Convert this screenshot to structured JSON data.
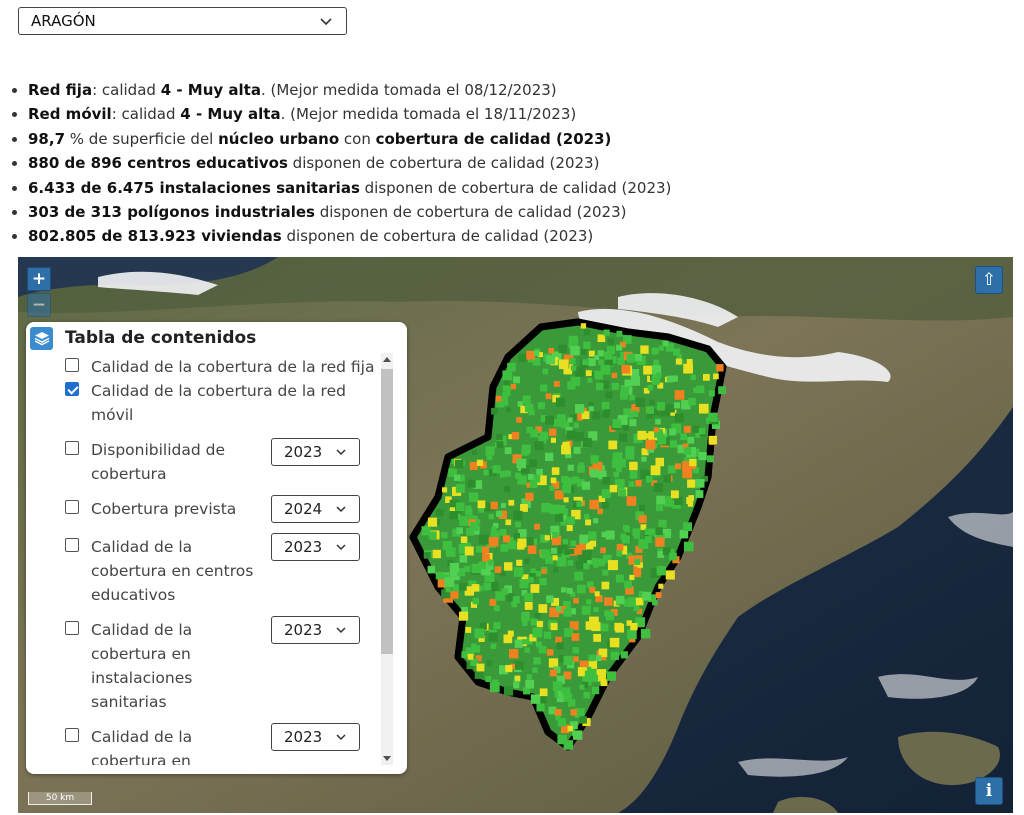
{
  "region_select": {
    "value": "ARAGÓN",
    "icon": "chevron-down-icon"
  },
  "stats": [
    {
      "b1": "Red fija",
      "t1": ": calidad ",
      "b2": "4 - Muy alta",
      "t2": ". (Mejor medida tomada el 08/12/2023)"
    },
    {
      "b1": "Red móvil",
      "t1": ": calidad ",
      "b2": "4 - Muy alta",
      "t2": ". (Mejor medida tomada el 18/11/2023)"
    },
    {
      "b1": "98,7",
      "t1": " % de superficie del ",
      "b2": "núcleo urbano",
      "t2": " con ",
      "b3": "cobertura de calidad (2023)"
    },
    {
      "b1": "880 de 896 centros educativos",
      "t1": " disponen de cobertura de calidad (2023)"
    },
    {
      "b1": "6.433 de 6.475 instalaciones sanitarias",
      "t1": " disponen de cobertura de calidad (2023)"
    },
    {
      "b1": "303 de 313 polígonos industriales",
      "t1": " disponen de cobertura de calidad (2023)"
    },
    {
      "b1": "802.805 de 813.923 viviendas",
      "t1": " disponen de cobertura de calidad (2023)"
    }
  ],
  "map": {
    "zoom_in": "+",
    "zoom_out": "−",
    "top_button": "⇧",
    "info_button": "i",
    "scale": "50 km",
    "colors": {
      "accent": "#2f6fa8",
      "coverage_high": "#3fbf3f",
      "coverage_mid": "#e8e020",
      "coverage_low": "#f08020"
    }
  },
  "toc": {
    "title": "Tabla de contenidos",
    "icon": "layers-icon",
    "layers": [
      {
        "label": "Calidad de la cobertura de la red fija",
        "checked": false,
        "year": null
      },
      {
        "label": "Calidad de la cobertura de la red móvil",
        "checked": true,
        "year": null
      },
      {
        "label": "Disponibilidad de cobertura",
        "checked": false,
        "year": "2023"
      },
      {
        "label": "Cobertura prevista",
        "checked": false,
        "year": "2024"
      },
      {
        "label": "Calidad de la cobertura en centros educativos",
        "checked": false,
        "year": "2023"
      },
      {
        "label": "Calidad de la cobertura en instalaciones sanitarias",
        "checked": false,
        "year": "2023"
      },
      {
        "label": "Calidad de la cobertura en",
        "checked": false,
        "year": "2023"
      }
    ]
  }
}
